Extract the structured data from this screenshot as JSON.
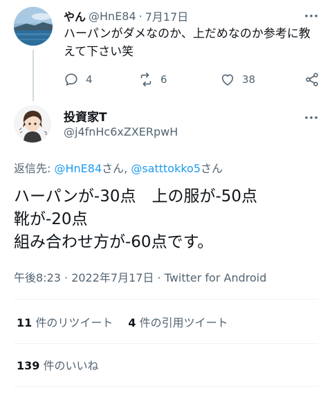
{
  "parent_tweet": {
    "name": "やん",
    "handle": "@HnE84",
    "separator": "·",
    "date": "7月17日",
    "text_lines": [
      "ハーパンがダメなのか、上だめなのか参考に教",
      "えて下さい笑"
    ],
    "more_icon": "more-horizontal-icon",
    "actions": {
      "reply_count": "4",
      "retweet_count": "6",
      "like_count": "38"
    }
  },
  "main_tweet": {
    "name": "投資家T",
    "handle": "@j4fnHc6xZXERpwH",
    "replying_prefix": "返信先: ",
    "mention_1": "@HnE84",
    "san_1": "さん, ",
    "mention_2": "@satttokko5",
    "san_2": "さん",
    "body_lines": [
      "ハーパンが-30点　上の服が-50点",
      "靴が-20点",
      "組み合わせ方が-60点です。"
    ],
    "meta": "午後8:23 · 2022年7月17日 · Twitter for Android",
    "retweets_count": "11",
    "retweets_label": " 件のリツイート",
    "quotes_count": "4",
    "quotes_label": " 件の引用ツイート",
    "likes_count": "139",
    "likes_label": " 件のいいね"
  },
  "colors": {
    "text": "#0f1419",
    "secondary": "#536471",
    "link": "#1d9bf0",
    "divider": "#eff3f4"
  }
}
